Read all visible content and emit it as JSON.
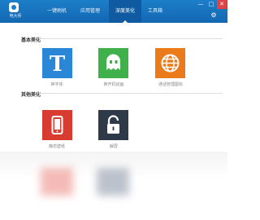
{
  "app": {
    "logo_text": "电大师"
  },
  "tabs": [
    {
      "label": "一键刷机"
    },
    {
      "label": "应用管理"
    },
    {
      "label": "深度美化"
    },
    {
      "label": "工具箱"
    }
  ],
  "sections": {
    "basic": {
      "title": "基本美化"
    },
    "other": {
      "title": "其他美化"
    }
  },
  "tiles": {
    "font": {
      "label": "换字体",
      "color": "#2a86d6",
      "icon": "letter-t-icon"
    },
    "boot": {
      "label": "换开机动画",
      "color": "#3fb04a",
      "icon": "ghost-icon"
    },
    "network": {
      "label": "通话管理图标",
      "color": "#ea7a1a",
      "icon": "globe-icon"
    },
    "wallpaper": {
      "label": "静态壁纸",
      "color": "#d83b30",
      "icon": "phone-icon"
    },
    "unlock": {
      "label": "解屏",
      "color": "#2f3a48",
      "icon": "unlock-icon"
    }
  },
  "window_controls": {
    "minimize": "—",
    "maximize": "□",
    "close": "✕",
    "settings": "⚙"
  }
}
